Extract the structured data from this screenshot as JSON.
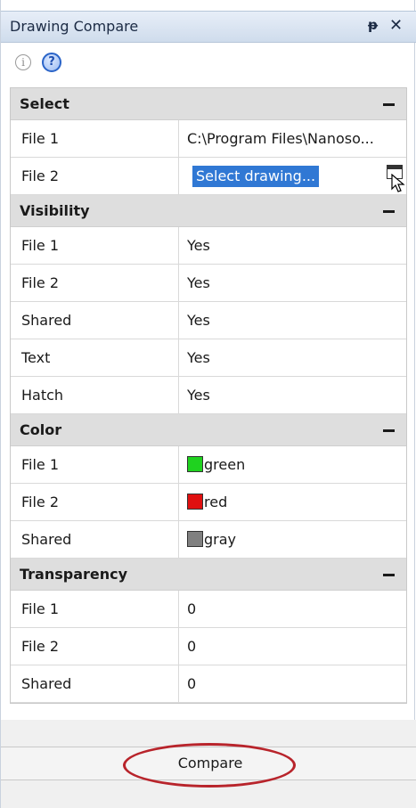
{
  "window": {
    "title": "Drawing Compare",
    "pin_glyph": "ᵽ",
    "close_glyph": "✕"
  },
  "toolbar": {
    "info_icon": "i",
    "help_icon": "?"
  },
  "sections": {
    "select": {
      "title": "Select",
      "rows": [
        {
          "name": "File 1",
          "value": "C:\\Program Files\\Nanoso..."
        },
        {
          "name": "File 2",
          "value": "Select drawing..."
        }
      ]
    },
    "visibility": {
      "title": "Visibility",
      "rows": [
        {
          "name": "File 1",
          "value": "Yes"
        },
        {
          "name": "File 2",
          "value": "Yes"
        },
        {
          "name": "Shared",
          "value": "Yes"
        },
        {
          "name": "Text",
          "value": "Yes"
        },
        {
          "name": "Hatch",
          "value": "Yes"
        }
      ]
    },
    "color": {
      "title": "Color",
      "rows": [
        {
          "name": "File 1",
          "value": "green",
          "swatch": "#1fd21f"
        },
        {
          "name": "File 2",
          "value": "red",
          "swatch": "#e01010"
        },
        {
          "name": "Shared",
          "value": "gray",
          "swatch": "#808080"
        }
      ]
    },
    "transparency": {
      "title": "Transparency",
      "rows": [
        {
          "name": "File 1",
          "value": "0"
        },
        {
          "name": "File 2",
          "value": "0"
        },
        {
          "name": "Shared",
          "value": "0"
        }
      ]
    }
  },
  "footer": {
    "compare_label": "Compare",
    "highlight_color": "#b8242b"
  }
}
